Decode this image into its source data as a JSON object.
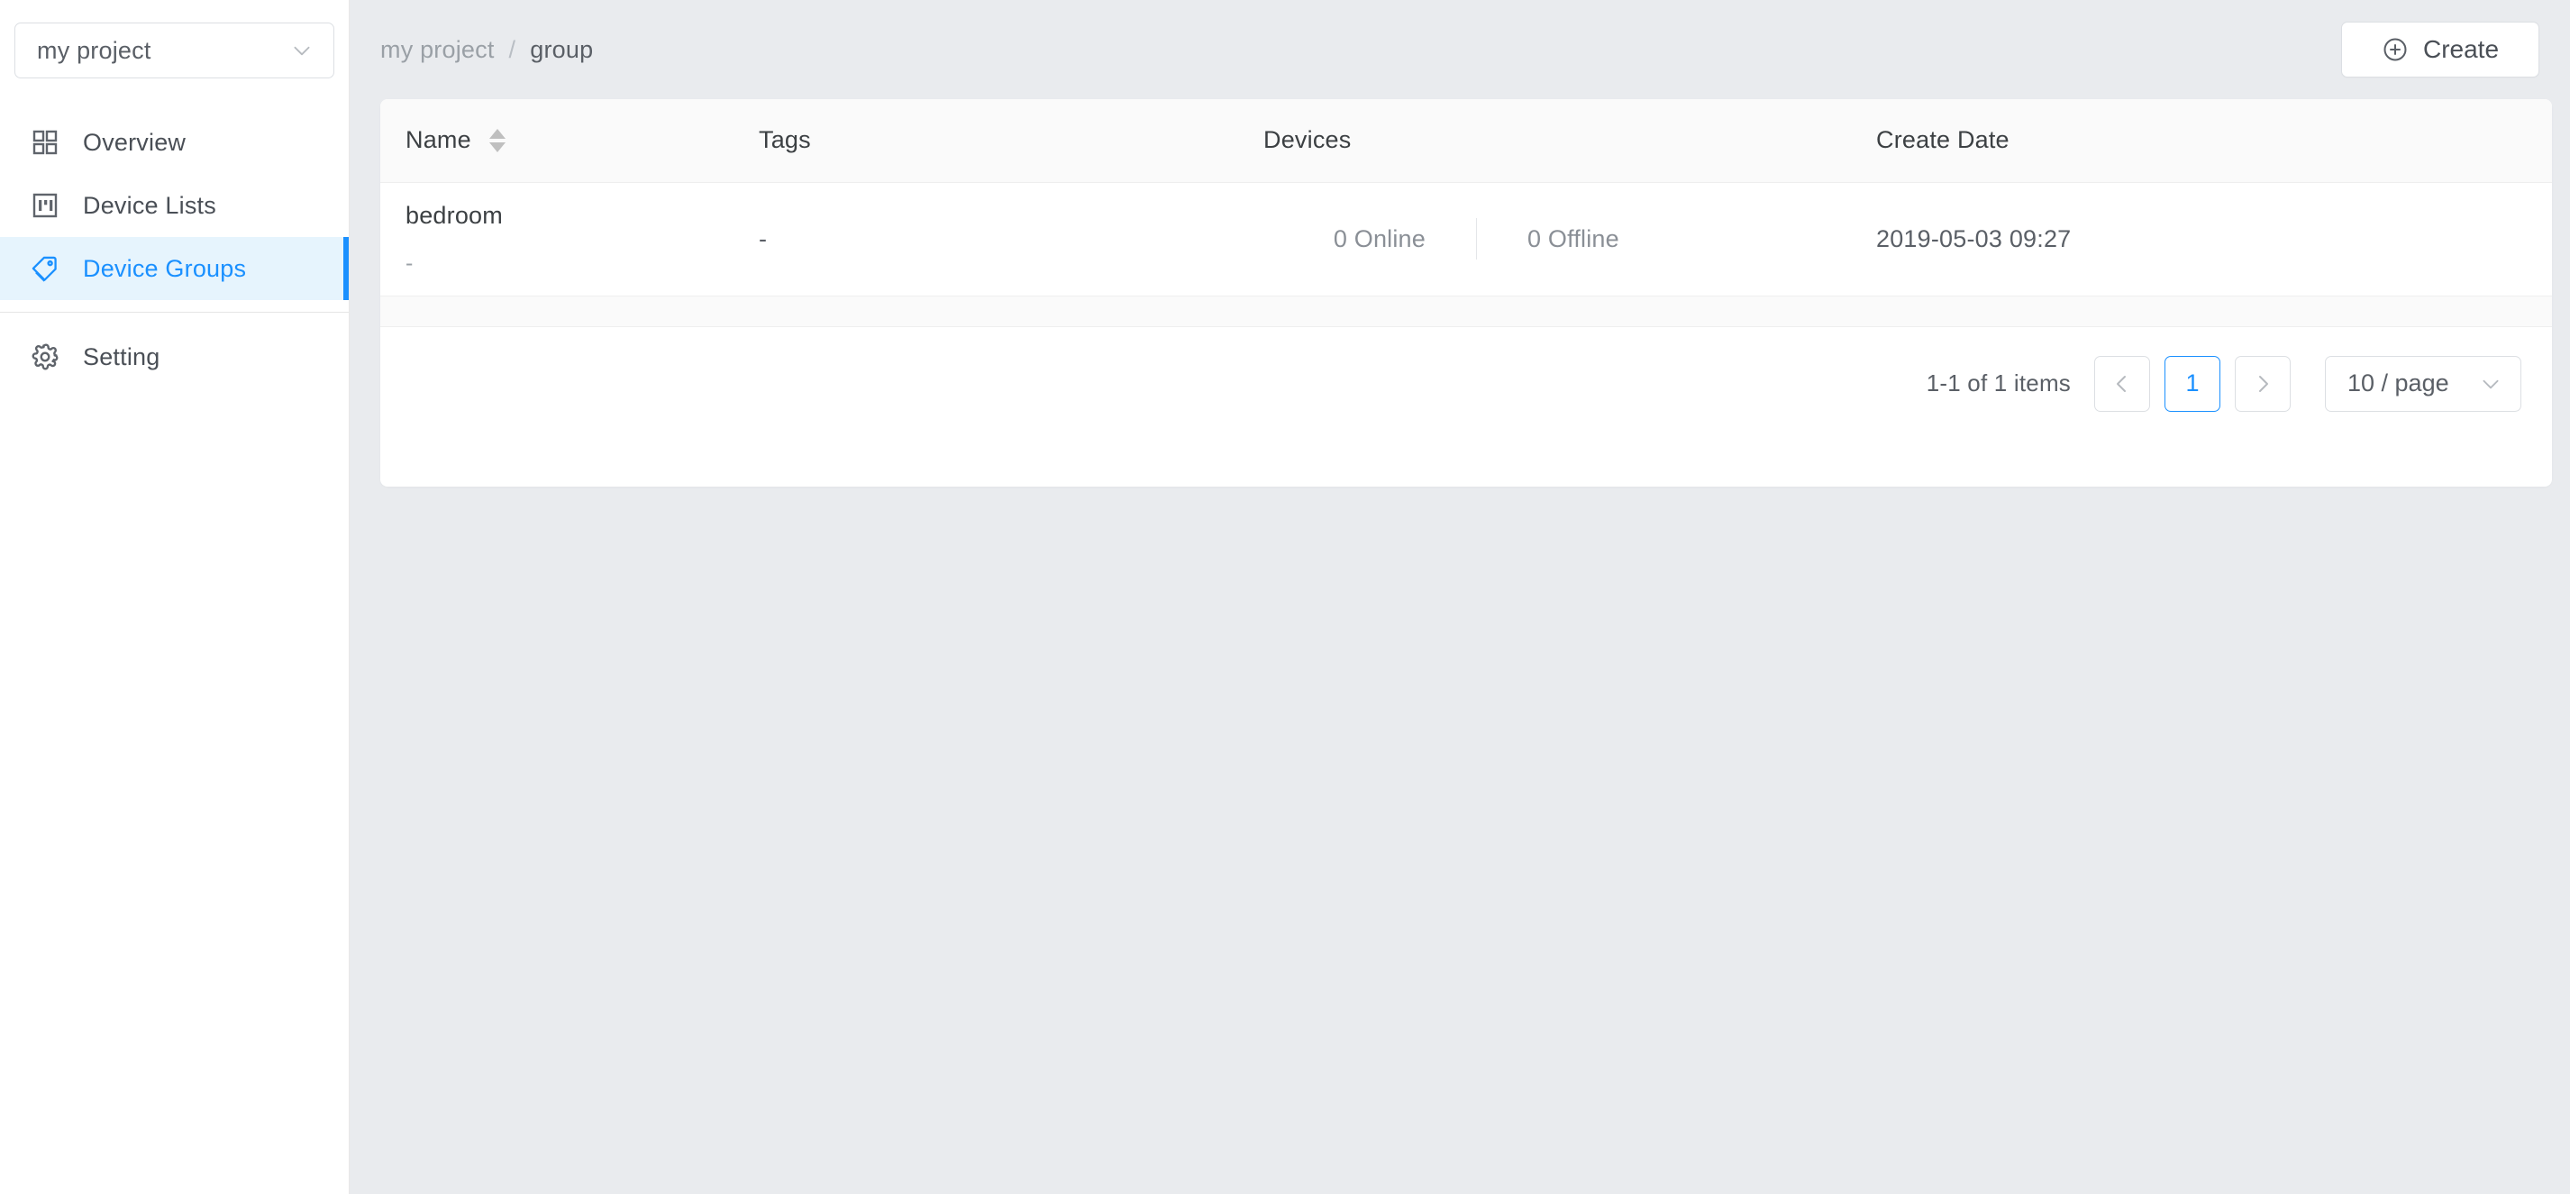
{
  "sidebar": {
    "project_selector": {
      "value": "my project",
      "icon": "chevron-down-icon"
    },
    "items": [
      {
        "label": "Overview",
        "icon": "grid-icon",
        "active": false
      },
      {
        "label": "Device Lists",
        "icon": "list-box-icon",
        "active": false
      },
      {
        "label": "Device Groups",
        "icon": "tag-icon",
        "active": true
      },
      {
        "label": "Setting",
        "icon": "gear-icon",
        "active": false
      }
    ]
  },
  "header": {
    "breadcrumb": {
      "parent": "my project",
      "separator": "/",
      "current": "group"
    },
    "create_button": {
      "label": "Create",
      "icon": "plus-circle-icon"
    }
  },
  "table": {
    "columns": [
      {
        "key": "name",
        "label": "Name",
        "sortable": true
      },
      {
        "key": "tags",
        "label": "Tags",
        "sortable": false
      },
      {
        "key": "devices",
        "label": "Devices",
        "sortable": false
      },
      {
        "key": "date",
        "label": "Create Date",
        "sortable": false
      }
    ],
    "rows": [
      {
        "name": "bedroom",
        "description": "-",
        "tags": "-",
        "devices_online": "0 Online",
        "devices_offline": "0 Offline",
        "create_date": "2019-05-03 09:27"
      }
    ]
  },
  "pagination": {
    "summary": "1-1 of 1 items",
    "prev_icon": "chevron-left-icon",
    "next_icon": "chevron-right-icon",
    "current_page": "1",
    "page_size": "10 / page",
    "page_size_icon": "chevron-down-icon"
  },
  "colors": {
    "accent": "#1a90ff",
    "active_bg": "#e6f4fd",
    "content_bg": "#e9ebee",
    "header_bg": "#fafafa",
    "text": "#3c4043",
    "muted": "#9aa0a6"
  }
}
